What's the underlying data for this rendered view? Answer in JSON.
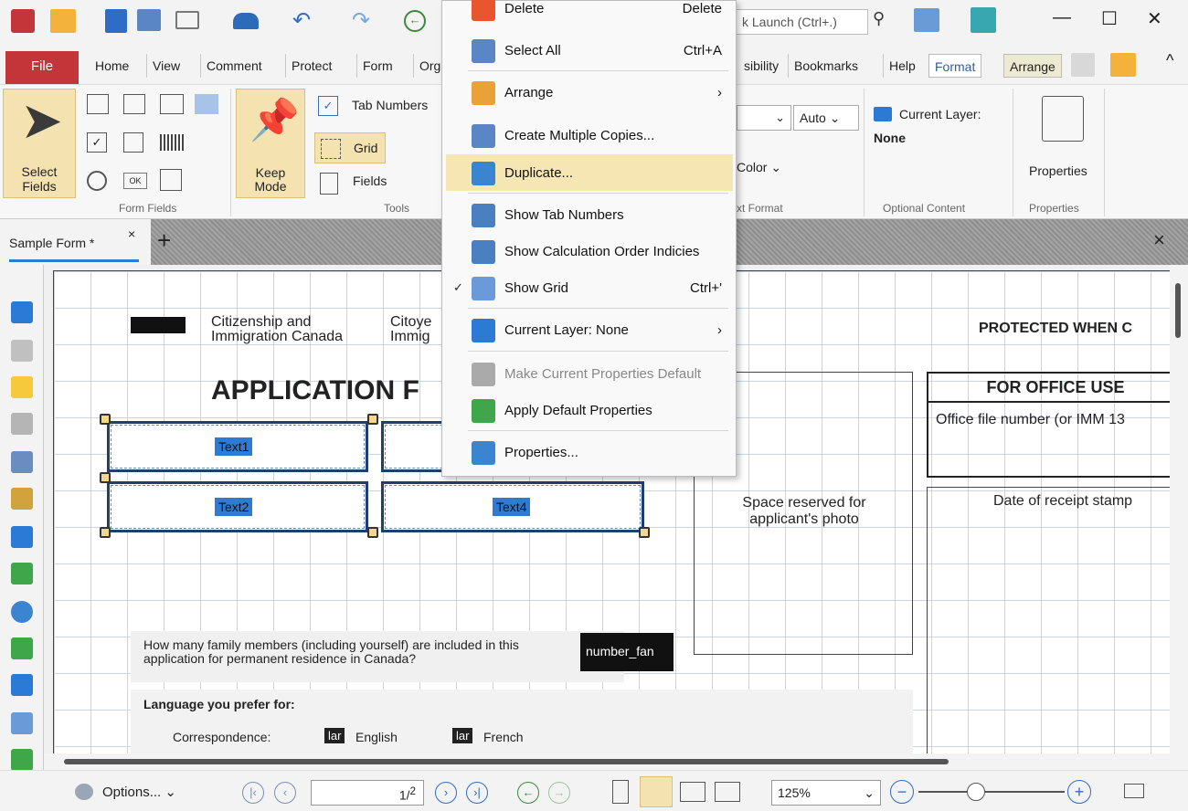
{
  "titlebar": {
    "quicklaunch_placeholder": "k Launch (Ctrl+.)",
    "min_glyph": "—",
    "max_glyph": "☐",
    "close_glyph": "✕"
  },
  "menubar": {
    "file": "File",
    "tabs": [
      "Home",
      "View",
      "Comment",
      "Protect",
      "Form",
      "Org"
    ],
    "tabs_right": [
      "sibility",
      "Bookmarks",
      "Help",
      "Format",
      "Arrange"
    ],
    "collapse": "^"
  },
  "ribbon": {
    "select_fields": "Select Fields",
    "keep_mode": "Keep Mode",
    "tab_numbers": "Tab Numbers",
    "grid": "Grid",
    "fields": "Fields",
    "font_size": "Auto",
    "color": "Color",
    "current_layer": "Current Layer:",
    "current_layer_value": "None",
    "properties": "Properties",
    "groups": {
      "form_fields": "Form Fields",
      "tools": "Tools",
      "text_format": "xt Format",
      "optional_content": "Optional Content",
      "properties": "Properties"
    }
  },
  "tabs": {
    "doc": "Sample Form *",
    "close": "×",
    "add": "+",
    "close_all": "×"
  },
  "page": {
    "agency_en": "Citizenship and Immigration Canada",
    "agency_fr_partial": "Citoye Immig",
    "protected": "PROTECTED WHEN C",
    "app_title": "APPLICATION F",
    "office_use": "FOR OFFICE USE",
    "office_file": "Office file number (or IMM 13",
    "receipt": "Date of receipt stamp",
    "photo": "Space reserved for applicant's photo",
    "family_q": "How many family members (including yourself) are included in this application for permanent residence in Canada?",
    "number_field": "number_fan",
    "language": "Language you prefer for:",
    "correspondence": "Correspondence:",
    "lar": "lar",
    "english": "English",
    "french": "French",
    "fields": [
      "Text1",
      "Text2",
      "Text4"
    ]
  },
  "context_menu": [
    {
      "label": "Delete",
      "shortcut": "Delete",
      "icon": "delete-icon",
      "color": "#e8552f"
    },
    {
      "label": "Select All",
      "shortcut": "Ctrl+A",
      "icon": "select-all-icon",
      "color": "#5b86c5"
    },
    {
      "label": "Arrange",
      "shortcut": "›",
      "icon": "arrange-icon",
      "color": "#e9a13a"
    },
    {
      "label": "Create Multiple Copies...",
      "shortcut": "",
      "icon": "multiple-copies-icon",
      "color": "#5b86c5"
    },
    {
      "label": "Duplicate...",
      "shortcut": "",
      "icon": "duplicate-icon",
      "color": "#3b84cf"
    },
    {
      "label": "Show Tab Numbers",
      "shortcut": "",
      "icon": "tab-numbers-icon",
      "color": "#4a7fc0"
    },
    {
      "label": "Show Calculation Order Indicies",
      "shortcut": "",
      "icon": "calc-order-icon",
      "color": "#4a7fc0"
    },
    {
      "label": "Show Grid",
      "shortcut": "Ctrl+'",
      "icon": "grid-icon",
      "color": "#6a9bd8"
    },
    {
      "label": "Current Layer: None",
      "shortcut": "›",
      "icon": "layer-icon",
      "color": "#2b7bd6"
    },
    {
      "label": "Make Current Properties Default",
      "shortcut": "",
      "icon": "make-default-icon",
      "color": "#aaaaaa"
    },
    {
      "label": "Apply Default Properties",
      "shortcut": "",
      "icon": "apply-default-icon",
      "color": "#3fa64a"
    },
    {
      "label": "Properties...",
      "shortcut": "",
      "icon": "properties-icon",
      "color": "#3b84cf"
    }
  ],
  "statusbar": {
    "options": "Options...",
    "page": "1",
    "page_total": "2",
    "zoom": "125%"
  },
  "colors": {
    "accent": "#2d7bd4",
    "file_tab": "#c4353a",
    "highlight": "#f6e6b4"
  }
}
